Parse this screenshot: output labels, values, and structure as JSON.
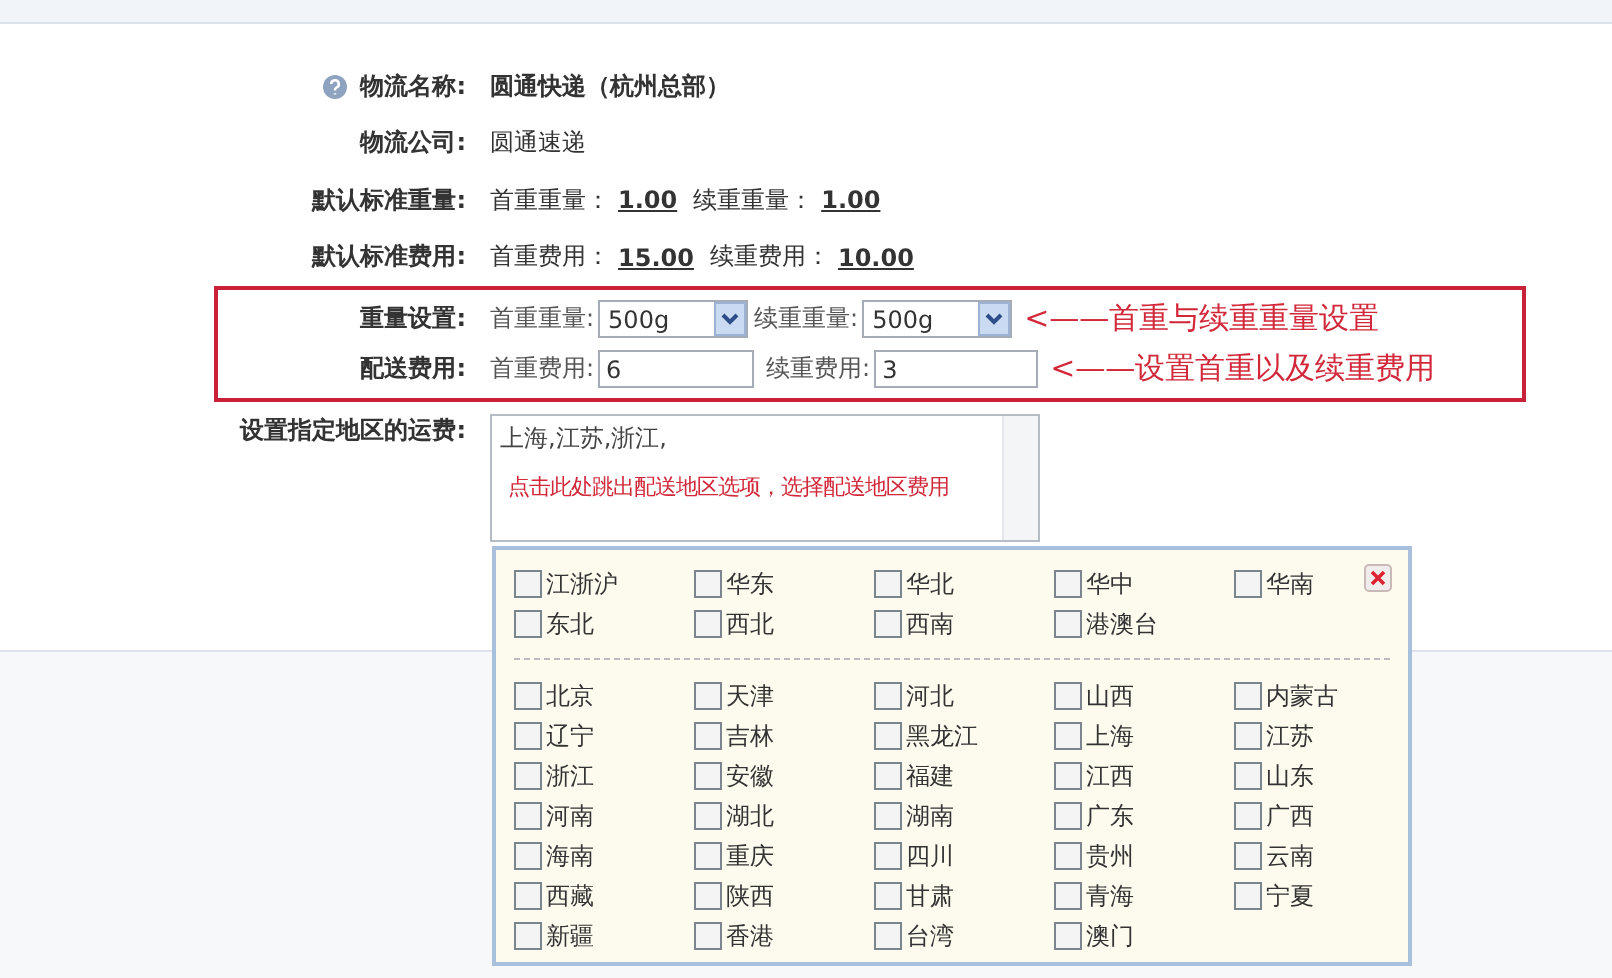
{
  "fields": [
    {
      "kind": "name",
      "label": "物流名称:",
      "value": "圆通快递（杭州总部）"
    },
    {
      "kind": "text",
      "label": "物流公司:",
      "value": "圆通速递"
    },
    {
      "kind": "pairs",
      "label": "默认标准重量:",
      "pairs": [
        {
          "label": "首重重量：",
          "value": "1.00"
        },
        {
          "label": "续重重量：",
          "value": "1.00"
        }
      ]
    },
    {
      "kind": "pairs",
      "label": "默认标准费用:",
      "pairs": [
        {
          "label": "首重费用：",
          "value": "15.00"
        },
        {
          "label": "续重费用：",
          "value": "10.00"
        }
      ]
    }
  ],
  "settings": [
    {
      "kind": "selects",
      "label": "重量设置:",
      "controls": [
        {
          "label": "首重重量:",
          "value": "500g"
        },
        {
          "label": "续重重量:",
          "value": "500g"
        }
      ],
      "note": "<——首重与续重重量设置"
    },
    {
      "kind": "inputs",
      "label": "配送费用:",
      "controls": [
        {
          "label": "首重费用:",
          "value": "6"
        },
        {
          "label": "续重费用:",
          "value": "3"
        }
      ],
      "note": "<——设置首重以及续重费用"
    }
  ],
  "regions_field": {
    "label": "设置指定地区的运费:",
    "value": "上海,江苏,浙江,",
    "note": "点击此处跳出配送地区选项，选择配送地区费用"
  },
  "region_picker": {
    "groups": [
      {
        "label": "江浙沪",
        "checked": false
      },
      {
        "label": "华东",
        "checked": false
      },
      {
        "label": "华北",
        "checked": false
      },
      {
        "label": "华中",
        "checked": false
      },
      {
        "label": "华南",
        "checked": false
      },
      {
        "label": "东北",
        "checked": false
      },
      {
        "label": "西北",
        "checked": false
      },
      {
        "label": "西南",
        "checked": false
      },
      {
        "label": "港澳台",
        "checked": false
      }
    ],
    "provinces": [
      {
        "label": "北京",
        "checked": false
      },
      {
        "label": "天津",
        "checked": false
      },
      {
        "label": "河北",
        "checked": false
      },
      {
        "label": "山西",
        "checked": false
      },
      {
        "label": "内蒙古",
        "checked": false
      },
      {
        "label": "辽宁",
        "checked": false
      },
      {
        "label": "吉林",
        "checked": false
      },
      {
        "label": "黑龙江",
        "checked": false
      },
      {
        "label": "上海",
        "checked": false
      },
      {
        "label": "江苏",
        "checked": false
      },
      {
        "label": "浙江",
        "checked": false
      },
      {
        "label": "安徽",
        "checked": false
      },
      {
        "label": "福建",
        "checked": false
      },
      {
        "label": "江西",
        "checked": false
      },
      {
        "label": "山东",
        "checked": false
      },
      {
        "label": "河南",
        "checked": false
      },
      {
        "label": "湖北",
        "checked": false
      },
      {
        "label": "湖南",
        "checked": false
      },
      {
        "label": "广东",
        "checked": false
      },
      {
        "label": "广西",
        "checked": false
      },
      {
        "label": "海南",
        "checked": false
      },
      {
        "label": "重庆",
        "checked": false
      },
      {
        "label": "四川",
        "checked": false
      },
      {
        "label": "贵州",
        "checked": false
      },
      {
        "label": "云南",
        "checked": false
      },
      {
        "label": "西藏",
        "checked": false
      },
      {
        "label": "陕西",
        "checked": false
      },
      {
        "label": "甘肃",
        "checked": false
      },
      {
        "label": "青海",
        "checked": false
      },
      {
        "label": "宁夏",
        "checked": false
      },
      {
        "label": "新疆",
        "checked": false
      },
      {
        "label": "香港",
        "checked": false
      },
      {
        "label": "台湾",
        "checked": false
      },
      {
        "label": "澳门",
        "checked": false
      }
    ]
  }
}
